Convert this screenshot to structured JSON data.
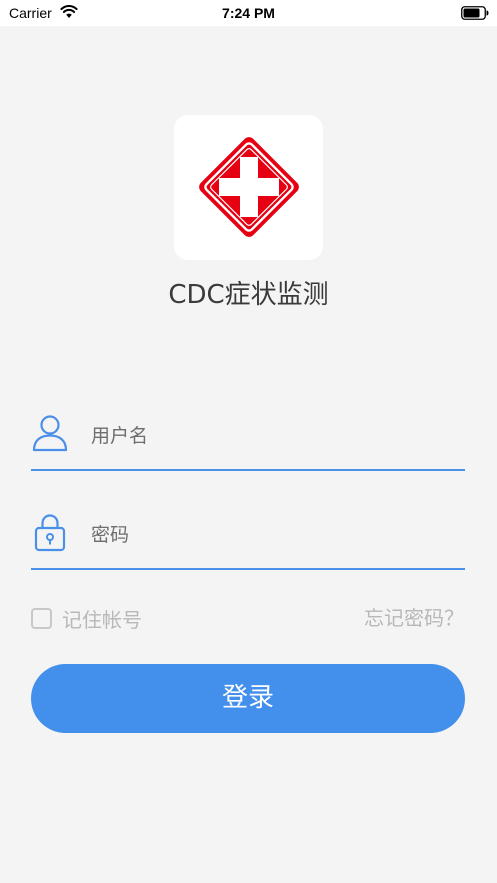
{
  "status_bar": {
    "carrier": "Carrier",
    "time": "7:24 PM"
  },
  "app": {
    "name": "CDC症状监测",
    "logo_icon": "red-cross-icon",
    "logo_color": "#e60012"
  },
  "form": {
    "username_placeholder": "用户名",
    "password_placeholder": "密码",
    "remember_label": "记住帐号",
    "forgot_label": "忘记密码？",
    "login_label": "登录"
  },
  "colors": {
    "accent": "#4290ec",
    "background": "#f4f4f4",
    "muted_text": "#b8b8b8"
  }
}
